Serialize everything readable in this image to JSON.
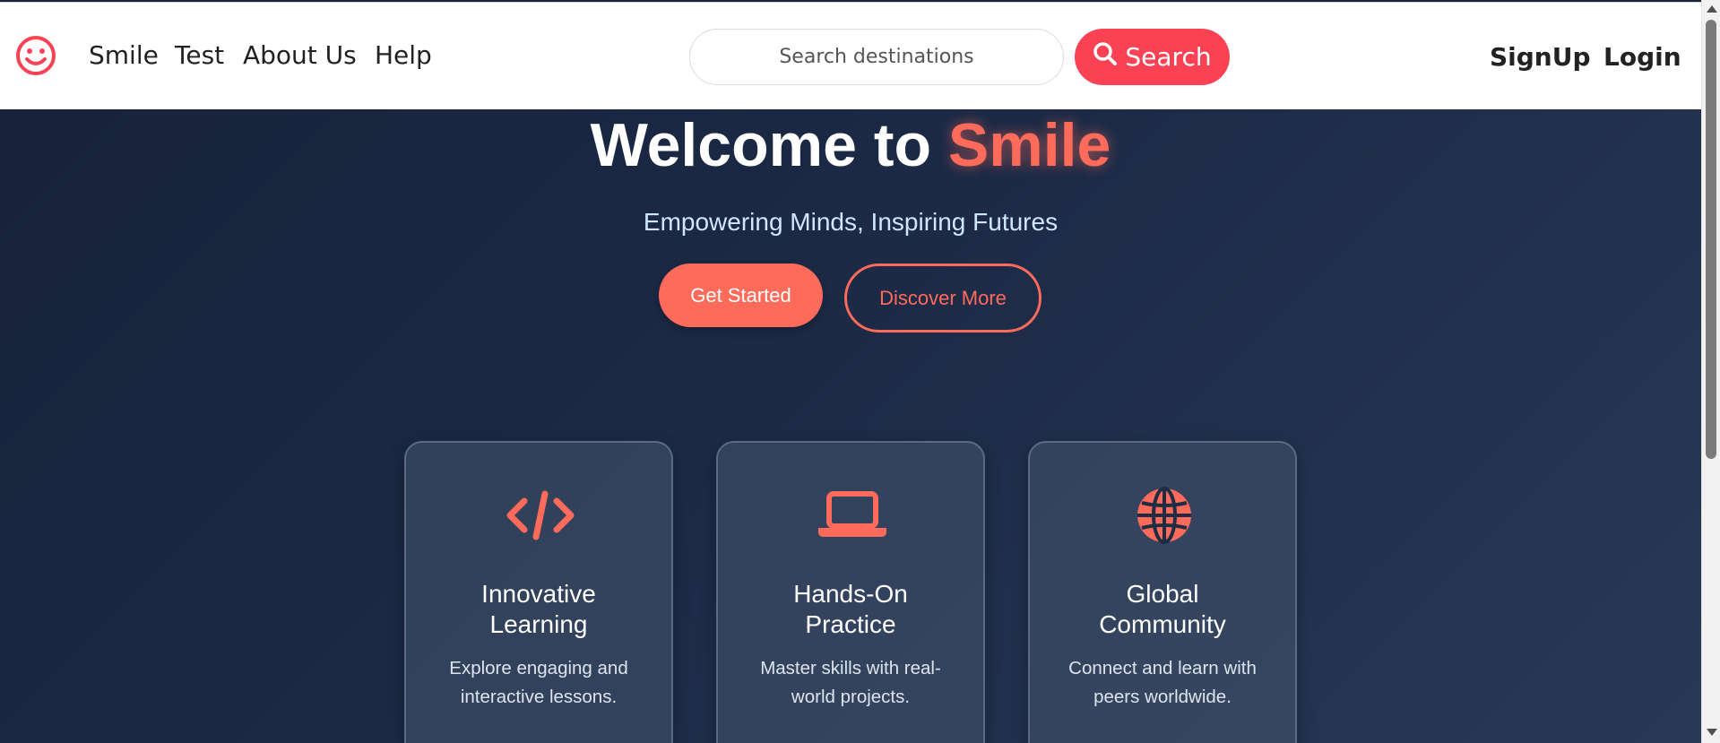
{
  "navbar": {
    "logo_icon": "smiley-face-icon",
    "links": [
      "Smile",
      "Test",
      "About Us",
      "Help"
    ],
    "search": {
      "placeholder": "Search destinations",
      "value": "",
      "button_label": "Search",
      "button_icon": "search-icon"
    },
    "signup_label": "SignUp",
    "login_label": "Login"
  },
  "hero": {
    "title_prefix": "Welcome to",
    "title_accent": "Smile",
    "subtitle": "Empowering Minds, Inspiring Futures",
    "primary_button": "Get Started",
    "secondary_button": "Discover More"
  },
  "features": [
    {
      "icon": "code-icon",
      "title": "Innovative Learning",
      "description": "Explore engaging and interactive lessons."
    },
    {
      "icon": "laptop-icon",
      "title": "Hands-On Practice",
      "description": "Master skills with real-world projects."
    },
    {
      "icon": "globe-icon",
      "title": "Global Community",
      "description": "Connect and learn with peers worldwide."
    }
  ],
  "colors": {
    "brand": "#fb4254",
    "accent": "#ff6b5b",
    "hero_background": "#1a2437",
    "navbar_background": "#ffffff"
  }
}
